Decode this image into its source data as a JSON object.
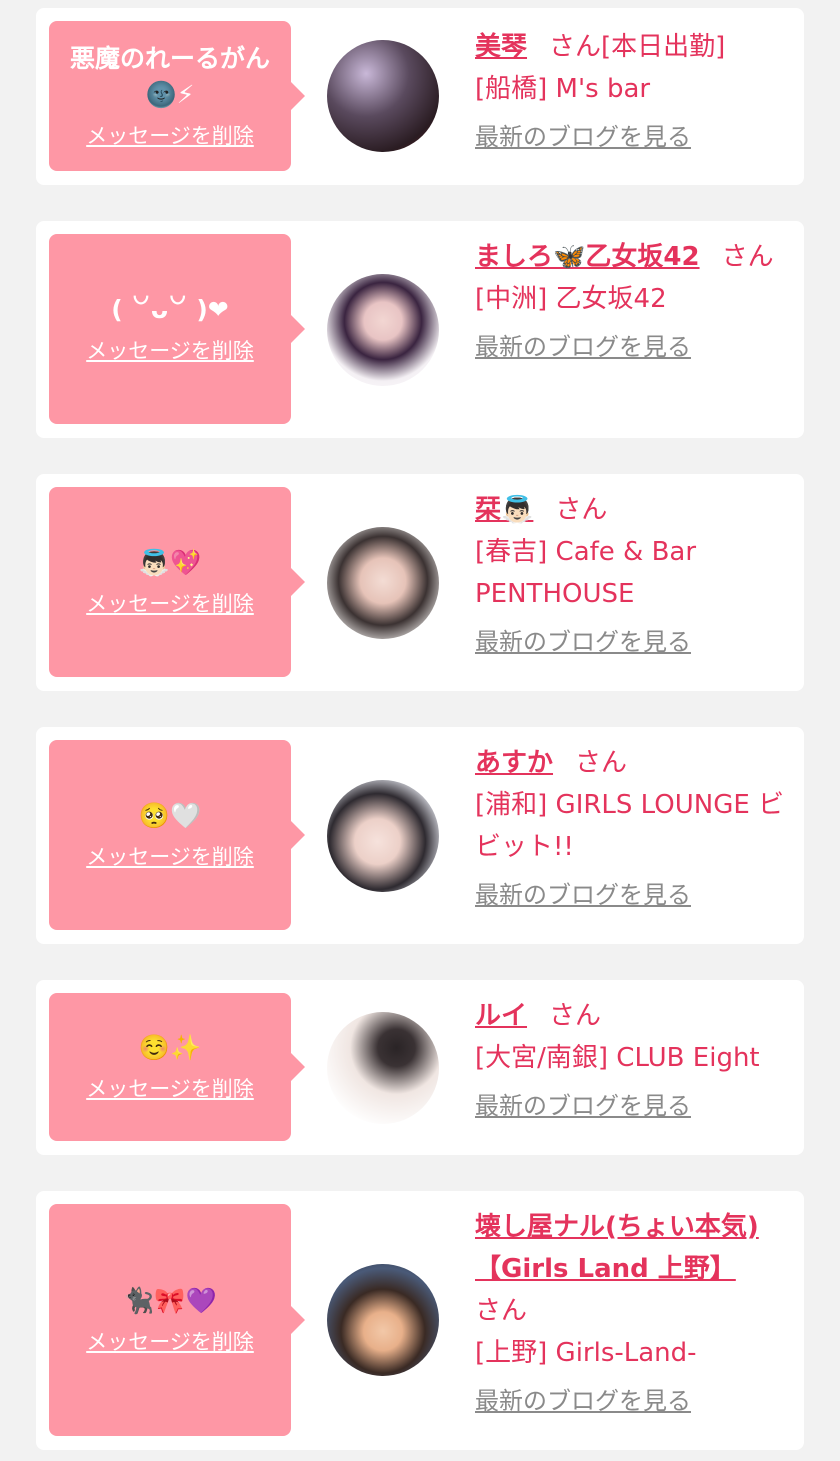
{
  "ui": {
    "delete_label": "メッセージを削除",
    "blog_label": "最新のブログを見る",
    "honorific": "さん"
  },
  "colors": {
    "page_bg": "#f2f2f2",
    "bubble_pink": "#fe97a5",
    "accent_red": "#e4335c",
    "link_gray": "#8a8a8a"
  },
  "messages": [
    {
      "message": "悪魔のれーるがん\n🌚⚡",
      "cast_name": "美琴",
      "status": "[本日出勤]",
      "shop": "[船橋] M's bar",
      "avatar_icon": "profile-photo-icon"
    },
    {
      "message": "( ꒡ᴗ꒡ )❤",
      "cast_name": "ましろ🦋乙女坂42",
      "status": "",
      "shop": "[中洲] 乙女坂42",
      "avatar_icon": "profile-photo-icon"
    },
    {
      "message": "👼🏻💖",
      "cast_name": "栞👼🏻",
      "status": "",
      "shop": "[春吉] Cafe & Bar PENTHOUSE",
      "avatar_icon": "profile-photo-icon"
    },
    {
      "message": "🥺🤍",
      "cast_name": "あすか",
      "status": "",
      "shop": "[浦和] GIRLS LOUNGE ビビット!!",
      "avatar_icon": "profile-photo-icon"
    },
    {
      "message": "☺️✨",
      "cast_name": "ルイ",
      "status": "",
      "shop": "[大宮/南銀] CLUB Eight",
      "avatar_icon": "profile-photo-icon"
    },
    {
      "message": "🐈‍⬛🎀💜",
      "cast_name": "壊し屋ナル(ちょい本気)【Girls Land 上野】",
      "status": "",
      "shop": "[上野] Girls-Land-",
      "avatar_icon": "profile-photo-icon"
    }
  ]
}
